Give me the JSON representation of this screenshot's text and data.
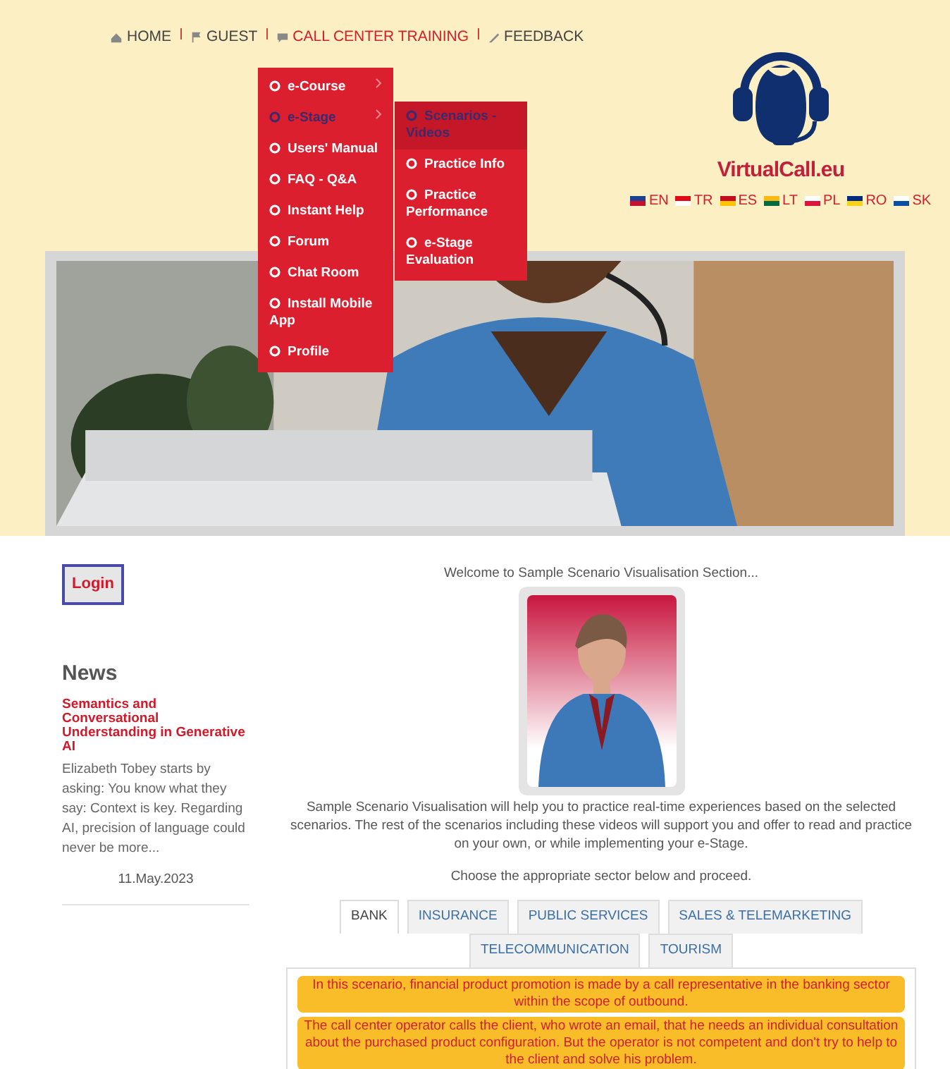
{
  "nav": [
    {
      "kind": "home",
      "label": "HOME",
      "selected": false
    },
    {
      "kind": "flag",
      "label": "GUEST",
      "selected": false
    },
    {
      "kind": "chat",
      "label": "CALL CENTER TRAINING",
      "selected": true
    },
    {
      "kind": "pencil",
      "label": "FEEDBACK",
      "selected": false
    }
  ],
  "menu": [
    {
      "label": "e-Course",
      "submenu": true,
      "selected": false
    },
    {
      "label": "e-Stage",
      "submenu": true,
      "selected": true
    },
    {
      "label": "Users' Manual",
      "submenu": false,
      "selected": false
    },
    {
      "label": "FAQ - Q&A",
      "submenu": false,
      "selected": false
    },
    {
      "label": "Instant Help",
      "submenu": false,
      "selected": false
    },
    {
      "label": "Forum",
      "submenu": false,
      "selected": false
    },
    {
      "label": "Chat Room",
      "submenu": false,
      "selected": false
    },
    {
      "label": "Install Mobile App",
      "submenu": false,
      "selected": false
    },
    {
      "label": "Profile",
      "submenu": false,
      "selected": false
    }
  ],
  "submenu": [
    {
      "label": "Scenarios - Videos",
      "selected": true
    },
    {
      "label": "Practice Info",
      "selected": false
    },
    {
      "label": "Practice Performance",
      "selected": false
    },
    {
      "label": "e-Stage Evaluation",
      "selected": false
    }
  ],
  "logo": {
    "text": "VirtualCall.eu"
  },
  "languages": [
    {
      "label": "EN"
    },
    {
      "label": "TR"
    },
    {
      "label": "ES"
    },
    {
      "label": "LT"
    },
    {
      "label": "PL"
    },
    {
      "label": "RO"
    },
    {
      "label": "SK"
    }
  ],
  "sidebar": {
    "login": "Login",
    "news_title": "News",
    "news": [
      {
        "headline": "Semantics and Conversational Understanding in Generative AI",
        "summary": "Elizabeth Tobey starts by asking: You know what they say: Context is key. Regarding AI, precision of language could never be more...",
        "date": "11.May.2023"
      }
    ]
  },
  "main": {
    "welcome": "Welcome to Sample Scenario Visualisation Section...",
    "intro": "Sample Scenario Visualisation will help you to practice real-time experiences based on the selected scenarios. The rest of the scenarios including these videos will support you and offer to read and practice on your own, or while implementing your e-Stage.",
    "prompt": "Choose the appropriate sector below and proceed.",
    "tabs": [
      {
        "label": "BANK",
        "selected": true
      },
      {
        "label": "INSURANCE",
        "selected": false
      },
      {
        "label": "PUBLIC SERVICES",
        "selected": false
      },
      {
        "label": "SALES & TELEMARKETING",
        "selected": false
      },
      {
        "label": "TELECOMMUNICATION",
        "selected": false
      },
      {
        "label": "TOURISM",
        "selected": false
      }
    ],
    "notes": [
      "In this scenario, financial product promotion is made by a call representative in the banking sector within the scope of outbound.",
      "The call center operator calls the client, who wrote an email, that he needs an individual consultation about the purchased product configuration. But the operator is not competent and don't try to help to the client and solve his problem."
    ]
  }
}
